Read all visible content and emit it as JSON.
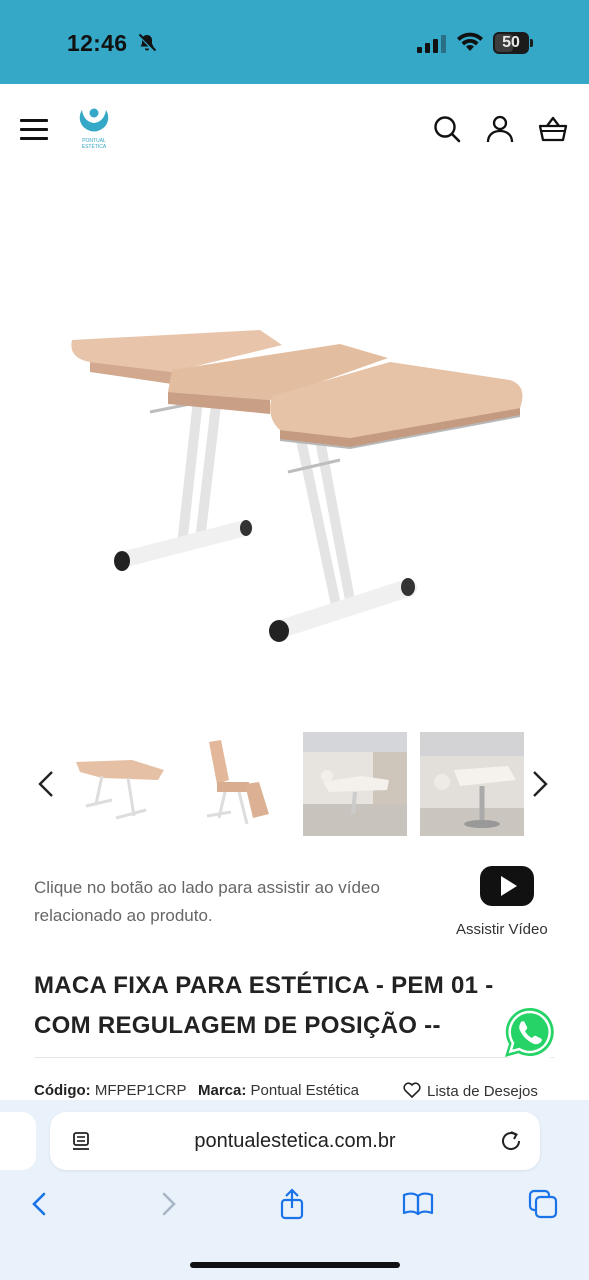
{
  "status_bar": {
    "time": "12:46",
    "battery": "50"
  },
  "header": {
    "logo_text_line1": "PONTUAL",
    "logo_text_line2": "ESTÉTICA",
    "brand_color": "#35a7c7"
  },
  "gallery": {
    "thumbnail_count": 4
  },
  "video": {
    "prompt": "Clique no botão ao lado para assistir ao vídeo relacionado ao produto.",
    "button_label": "Assistir Vídeo"
  },
  "product": {
    "title": "MACA FIXA PARA ESTÉTICA - PEM 01 - COM REGULAGEM DE POSIÇÃO --",
    "code_label": "Código:",
    "code_value": "MFPEP1CRP",
    "brand_label": "Marca:",
    "brand_value": "Pontual Estética",
    "wishlist_label": "Lista de Desejos"
  },
  "browser": {
    "url": "pontualestetica.com.br"
  }
}
